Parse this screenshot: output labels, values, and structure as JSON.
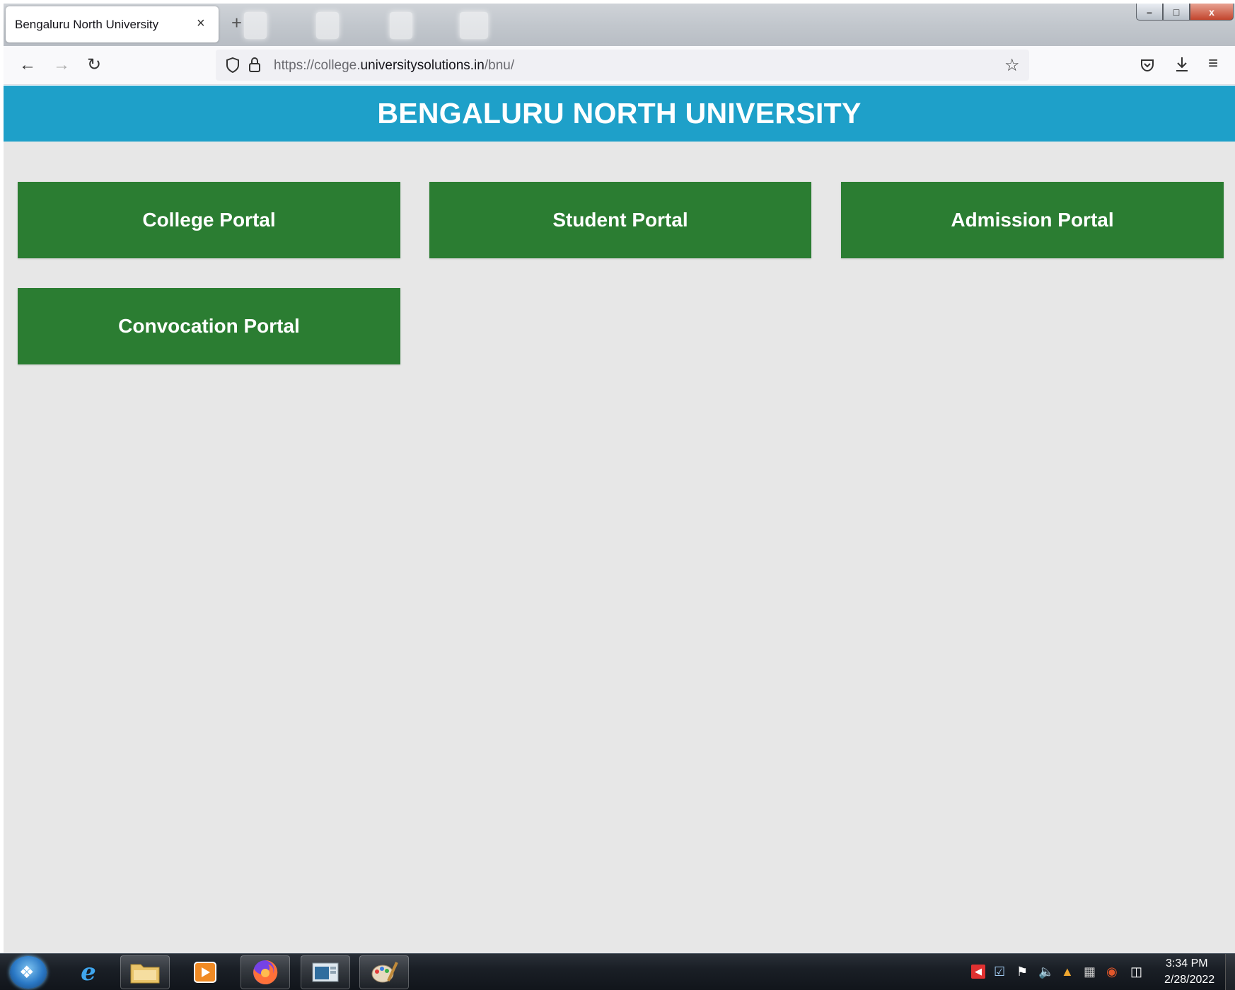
{
  "browser": {
    "tab_title": "Bengaluru North University",
    "tab_close": "×",
    "new_tab": "+",
    "url_prefix": "https://college.",
    "url_domain": "universitysolutions.in",
    "url_suffix": "/bnu/",
    "window_controls": {
      "minimize": "–",
      "maximize": "□",
      "close": "x"
    }
  },
  "page": {
    "banner_title": "BENGALURU NORTH UNIVERSITY",
    "banner_color": "#1ea0c9",
    "portal_color": "#2b7d32",
    "portals": [
      {
        "label": "College Portal"
      },
      {
        "label": "Student Portal"
      },
      {
        "label": "Admission Portal"
      },
      {
        "label": "Convocation Portal"
      }
    ]
  },
  "taskbar": {
    "apps": [
      "internet-explorer-icon",
      "file-explorer-icon",
      "media-player-icon",
      "firefox-icon",
      "window-app-icon",
      "paint-icon"
    ],
    "clock_time": "3:34 PM",
    "clock_date": "2/28/2022"
  }
}
